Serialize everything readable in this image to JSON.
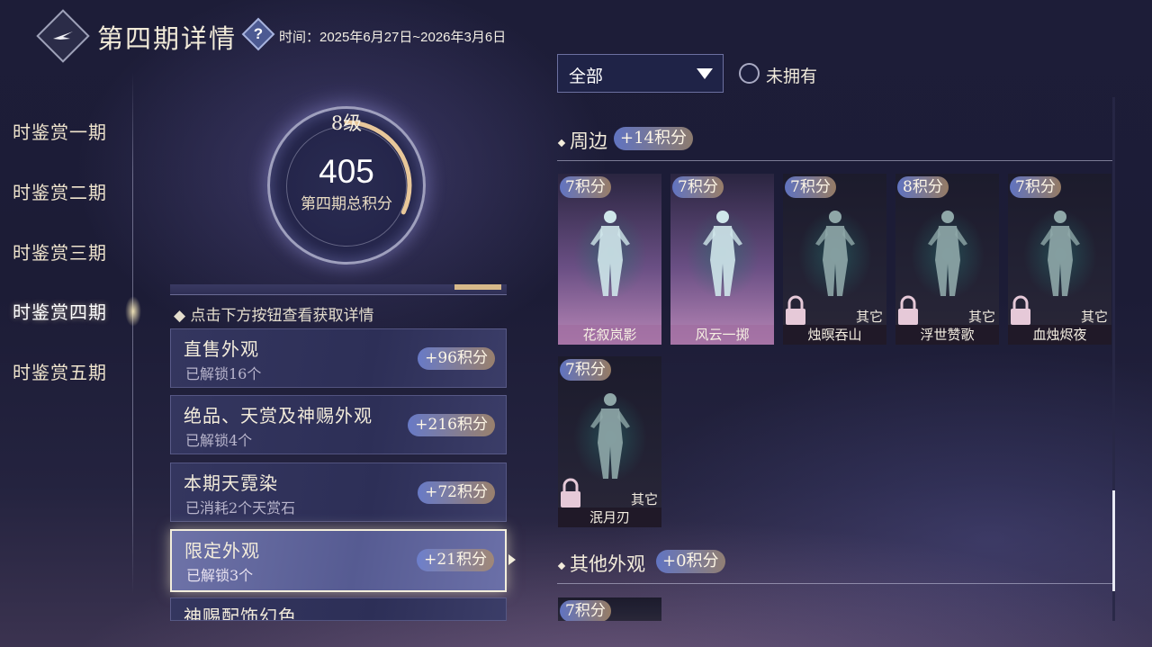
{
  "header": {
    "title": "第四期详情",
    "help_icon": "?",
    "period_text": "时间：2025年6月27日~2026年3月6日"
  },
  "nav": {
    "items": [
      {
        "label": "时鉴赏一期"
      },
      {
        "label": "时鉴赏二期"
      },
      {
        "label": "时鉴赏三期"
      },
      {
        "label": "时鉴赏四期",
        "active": true
      },
      {
        "label": "时鉴赏五期"
      }
    ]
  },
  "score": {
    "level": "8级",
    "total": "405",
    "label": "第四期总积分",
    "ring_progress_fraction": 0.32
  },
  "hint": "点击下方按钮查看获取详情",
  "categories": [
    {
      "title": "直售外观",
      "sub": "已解锁16个",
      "points": "+96积分"
    },
    {
      "title": "绝品、天赏及神赐外观",
      "sub": "已解锁4个",
      "points": "+216积分"
    },
    {
      "title": "本期天霓染",
      "sub": "已消耗2个天赏石",
      "points": "+72积分"
    },
    {
      "title": "限定外观",
      "sub": "已解锁3个",
      "points": "+21积分",
      "selected": true
    },
    {
      "title": "神赐配饰幻色",
      "sub": "",
      "points": ""
    }
  ],
  "filter": {
    "selected": "全部",
    "radio_label": "未拥有"
  },
  "sections": [
    {
      "title": "周边",
      "points": "+14积分",
      "items": [
        {
          "name": "花叙岚影",
          "points": "7积分",
          "owned": true
        },
        {
          "name": "风云一掷",
          "points": "7积分",
          "owned": true
        },
        {
          "name": "烛暝吞山",
          "points": "7积分",
          "owned": false,
          "tag": "其它"
        },
        {
          "name": "浮世赞歌",
          "points": "8积分",
          "owned": false,
          "tag": "其它"
        },
        {
          "name": "血烛烬夜",
          "points": "7积分",
          "owned": false,
          "tag": "其它"
        },
        {
          "name": "泯月刃",
          "points": "7积分",
          "owned": false,
          "tag": "其它"
        }
      ]
    },
    {
      "title": "其他外观",
      "points": "+0积分",
      "items": [
        {
          "name": "",
          "points": "7积分",
          "owned": false
        }
      ]
    }
  ],
  "colors": {
    "background": "#1d1d38",
    "accent_gold": "#d7b98a",
    "badge_blue": "#6478c8"
  }
}
